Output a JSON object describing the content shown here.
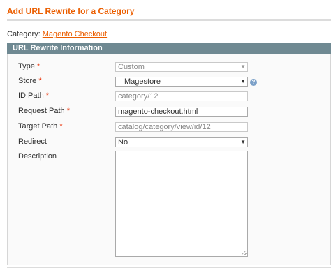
{
  "header": {
    "title": "Add URL Rewrite for a Category"
  },
  "category": {
    "prefix": "Category:",
    "name": "Magento Checkout"
  },
  "fieldset": {
    "title": "URL Rewrite Information"
  },
  "form": {
    "required_mark": "*",
    "type": {
      "label": "Type",
      "value": "Custom"
    },
    "store": {
      "label": "Store",
      "value": "Magestore"
    },
    "id_path": {
      "label": "ID Path",
      "value": "category/12"
    },
    "request_path": {
      "label": "Request Path",
      "value": "magento-checkout.html"
    },
    "target_path": {
      "label": "Target Path",
      "value": "catalog/category/view/id/12"
    },
    "redirect": {
      "label": "Redirect",
      "value": "No"
    },
    "description": {
      "label": "Description",
      "value": ""
    }
  },
  "icons": {
    "dropdown": "▼",
    "help": "?"
  }
}
